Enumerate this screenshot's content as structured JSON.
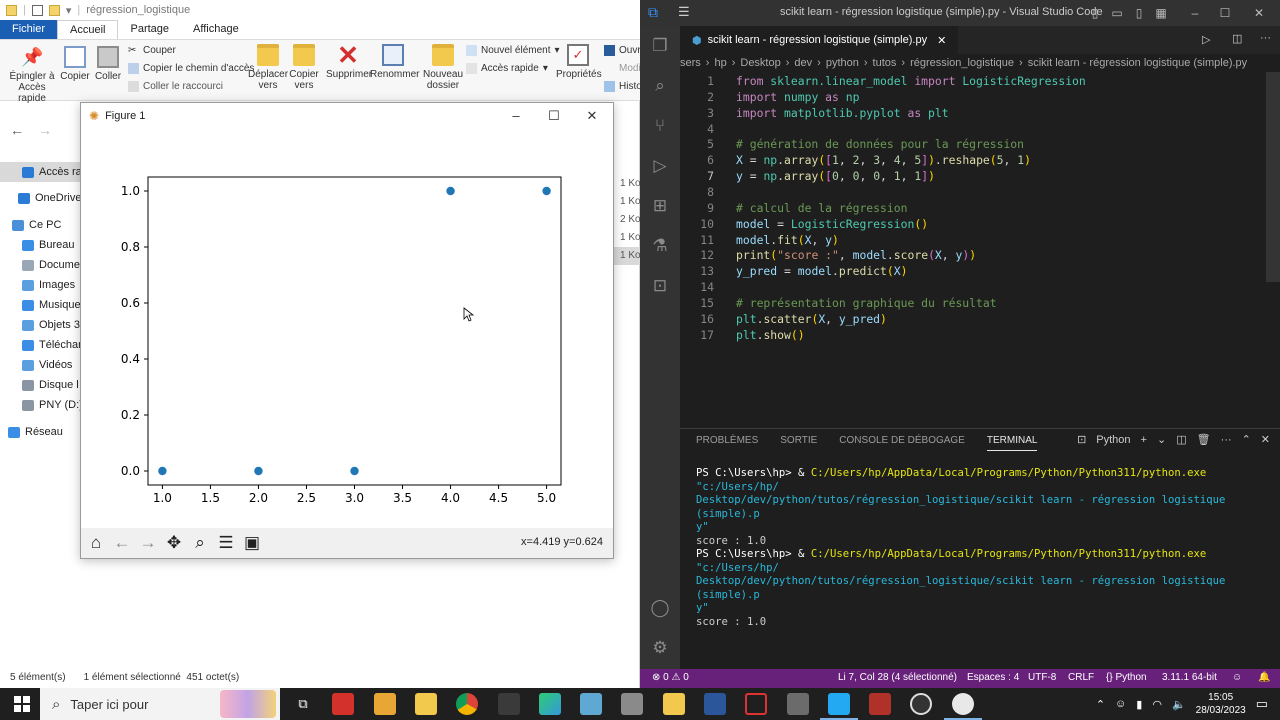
{
  "explorer": {
    "title": "régression_logistique",
    "tabs": [
      "Fichier",
      "Accueil",
      "Partage",
      "Affichage"
    ],
    "ribbon": {
      "pin": "Épingler à\nAccès rapide",
      "copy": "Copier",
      "paste": "Coller",
      "cut": "Couper",
      "copy_path": "Copier le chemin d'accès",
      "paste_shortcut": "Coller le raccourci",
      "move_to": "Déplacer\nvers",
      "copy_to": "Copier\nvers",
      "delete": "Supprimer",
      "rename": "Renommer",
      "new_folder": "Nouveau\ndossier",
      "new_item": "Nouvel élément",
      "easy_access": "Accès rapide",
      "properties": "Propriétés",
      "open": "Ouvri",
      "modify": "Modi",
      "history": "Histo"
    },
    "nav": [
      {
        "label": "Accès rap",
        "icon": "star-icon",
        "color": "#2b7bd6"
      },
      {
        "label": "OneDrive",
        "icon": "cloud-icon",
        "color": "#2b7bd6"
      },
      {
        "label": "Ce PC",
        "icon": "computer-icon",
        "color": "#4a90d9"
      },
      {
        "label": "Bureau",
        "icon": "desktop-icon",
        "color": "#3a8ee6"
      },
      {
        "label": "Docume",
        "icon": "documents-icon",
        "color": "#9aa7b5"
      },
      {
        "label": "Images",
        "icon": "images-icon",
        "color": "#5aa0e0"
      },
      {
        "label": "Musique",
        "icon": "music-icon",
        "color": "#3a8ee6"
      },
      {
        "label": "Objets 3",
        "icon": "objects3d-icon",
        "color": "#5aa0e0"
      },
      {
        "label": "Téléchar",
        "icon": "download-icon",
        "color": "#3a8ee6"
      },
      {
        "label": "Vidéos",
        "icon": "video-icon",
        "color": "#5aa0e0"
      },
      {
        "label": "Disque l",
        "icon": "disk-icon",
        "color": "#8a96a3"
      },
      {
        "label": "PNY (D:)",
        "icon": "usb-icon",
        "color": "#8a96a3"
      },
      {
        "label": "Réseau",
        "icon": "network-icon",
        "color": "#3a8ee6"
      }
    ],
    "right_sizes": [
      "1 Ko",
      "1 Ko",
      "2 Ko",
      "1 Ko",
      "1 Ko"
    ],
    "status_count": "5 élément(s)",
    "status_selected": "1 élément sélectionné  451 octet(s)"
  },
  "figure": {
    "title": "Figure 1",
    "coords": "x=4.419 y=0.624"
  },
  "chart_data": {
    "type": "scatter",
    "x": [
      1,
      2,
      3,
      4,
      5
    ],
    "y": [
      0,
      0,
      0,
      1,
      1
    ],
    "xlim": [
      0.85,
      5.15
    ],
    "ylim": [
      -0.05,
      1.05
    ],
    "xticks": [
      "1.0",
      "1.5",
      "2.0",
      "2.5",
      "3.0",
      "3.5",
      "4.0",
      "4.5",
      "5.0"
    ],
    "yticks": [
      "0.0",
      "0.2",
      "0.4",
      "0.6",
      "0.8",
      "1.0"
    ],
    "point_color": "#1f77b4",
    "grid": false
  },
  "vscode": {
    "title": "scikit learn - régression logistique (simple).py - Visual Studio Code",
    "tab": "scikit learn - régression logistique (simple).py",
    "breadcrumb": [
      "sers",
      "hp",
      "Desktop",
      "dev",
      "python",
      "tutos",
      "régression_logistique",
      "scikit learn - régression logistique (simple).py"
    ],
    "code": [
      {
        "n": "1",
        "t": "from sklearn.linear_model import LogisticRegression"
      },
      {
        "n": "2",
        "t": "import numpy as np"
      },
      {
        "n": "3",
        "t": "import matplotlib.pyplot as plt"
      },
      {
        "n": "4",
        "t": ""
      },
      {
        "n": "5",
        "t": "# génération de données pour la régression"
      },
      {
        "n": "6",
        "t": "X = np.array([1, 2, 3, 4, 5]).reshape(5, 1)"
      },
      {
        "n": "7",
        "t": "y = np.array([0, 0, 0, 1, 1])"
      },
      {
        "n": "8",
        "t": ""
      },
      {
        "n": "9",
        "t": "# calcul de la régression"
      },
      {
        "n": "10",
        "t": "model = LogisticRegression()"
      },
      {
        "n": "11",
        "t": "model.fit(X, y)"
      },
      {
        "n": "12",
        "t": "print(\"score :\", model.score(X, y))"
      },
      {
        "n": "13",
        "t": "y_pred = model.predict(X)"
      },
      {
        "n": "14",
        "t": ""
      },
      {
        "n": "15",
        "t": "# représentation graphique du résultat"
      },
      {
        "n": "16",
        "t": "plt.scatter(X, y_pred)"
      },
      {
        "n": "17",
        "t": "plt.show()"
      }
    ],
    "panel_tabs": [
      "PROBLÈMES",
      "SORTIE",
      "CONSOLE DE DÉBOGAGE",
      "TERMINAL"
    ],
    "panel_shell": "Python",
    "terminal": {
      "prompt": "PS C:\\Users\\hp> & ",
      "exe": "C:/Users/hp/AppData/Local/Programs/Python/Python311/python.exe",
      "arg1": " \"c:/Users/hp/",
      "arg2": "Desktop/dev/python/tutos/régression_logistique/scikit learn - régression logistique (simple).p",
      "arg3": "y\"",
      "score": "score : 1.0"
    },
    "status": {
      "errors": "⊗ 0 ⚠ 0",
      "position": "Li 7, Col 28 (4 sélectionné)",
      "spaces": "Espaces : 4",
      "encoding": "UTF-8",
      "eol": "CRLF",
      "language": "Python",
      "interpreter": "3.11.1 64-bit"
    }
  },
  "taskbar": {
    "search": "Taper ici pour",
    "time": "15:05",
    "date": "28/03/2023"
  }
}
